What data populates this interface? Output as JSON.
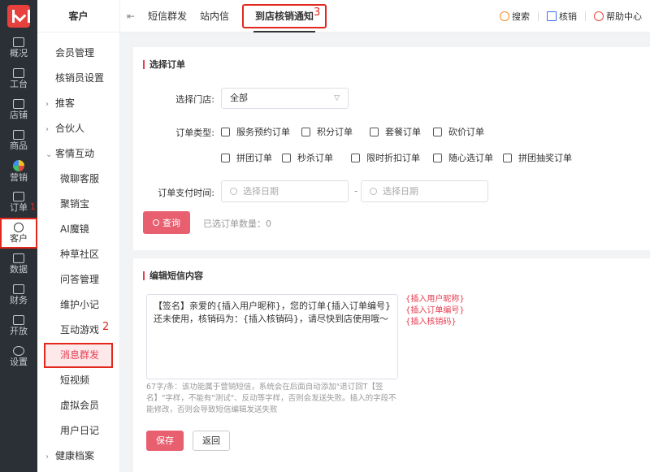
{
  "rail": {
    "items": [
      {
        "label": "概况",
        "icon": "chart-icon"
      },
      {
        "label": "工台",
        "icon": "monitor-icon"
      },
      {
        "label": "店铺",
        "icon": "store-icon"
      },
      {
        "label": "商品",
        "icon": "bag-icon"
      },
      {
        "label": "营销",
        "icon": "flower-icon"
      },
      {
        "label": "订单",
        "icon": "order-icon"
      },
      {
        "label": "客户",
        "icon": "user-icon"
      },
      {
        "label": "数据",
        "icon": "data-icon"
      },
      {
        "label": "财务",
        "icon": "finance-icon"
      },
      {
        "label": "开放",
        "icon": "code-icon"
      },
      {
        "label": "设置",
        "icon": "gear-icon"
      }
    ],
    "annotation": "1"
  },
  "sidebar": {
    "title": "客户",
    "items": [
      {
        "label": "会员管理"
      },
      {
        "label": "核销员设置"
      },
      {
        "label": "推客"
      },
      {
        "label": "合伙人"
      },
      {
        "label": "客情互动"
      },
      {
        "label": "微聊客服"
      },
      {
        "label": "聚销宝"
      },
      {
        "label": "AI魔镜"
      },
      {
        "label": "种草社区"
      },
      {
        "label": "问答管理"
      },
      {
        "label": "维护小记"
      },
      {
        "label": "互动游戏"
      },
      {
        "label": "消息群发"
      },
      {
        "label": "短视频"
      },
      {
        "label": "虚拟会员"
      },
      {
        "label": "用户日记"
      },
      {
        "label": "健康档案"
      }
    ],
    "annotation": "2"
  },
  "topbar": {
    "back_glyph": "⇤",
    "tabs": [
      {
        "label": "短信群发"
      },
      {
        "label": "站内信"
      },
      {
        "label": "到店核销通知"
      }
    ],
    "annotation": "3",
    "tools": [
      {
        "label": "搜索",
        "icon": "search-icon"
      },
      {
        "label": "核销",
        "icon": "scan-icon"
      },
      {
        "label": "帮助中心",
        "icon": "help-icon"
      }
    ]
  },
  "order_section": {
    "title": "选择订单",
    "store_label": "选择门店:",
    "store_value": "全部",
    "type_label": "订单类型:",
    "types": [
      "服务预约订单",
      "积分订单",
      "套餐订单",
      "砍价订单",
      "拼团订单",
      "秒杀订单",
      "限时折扣订单",
      "随心选订单",
      "拼团抽奖订单"
    ],
    "pay_time_label": "订单支付时间:",
    "date_placeholder": "选择日期",
    "date_separator": "-",
    "query_button": "查询",
    "selected_count": "已选订单数量：0"
  },
  "sms_section": {
    "title": "编辑短信内容",
    "content": "【签名】亲爱的{插入用户昵称}，您的订单{插入订单编号}还未使用，核销码为：{插入核销码}，请尽快到店使用哦～",
    "inserts": [
      "{插入用户昵称}",
      "{插入订单编号}",
      "{插入核销码}"
    ],
    "hint": "67字/条：该功能属于营销短信，系统会在后面自动添加\"退订回T【签名】\"字样，不能有\"测试\"、反动等字样，否则会发送失败。插入的字段不能修改，否则会导致短信编辑发送失败",
    "save_button": "保存",
    "back_button": "返回"
  }
}
